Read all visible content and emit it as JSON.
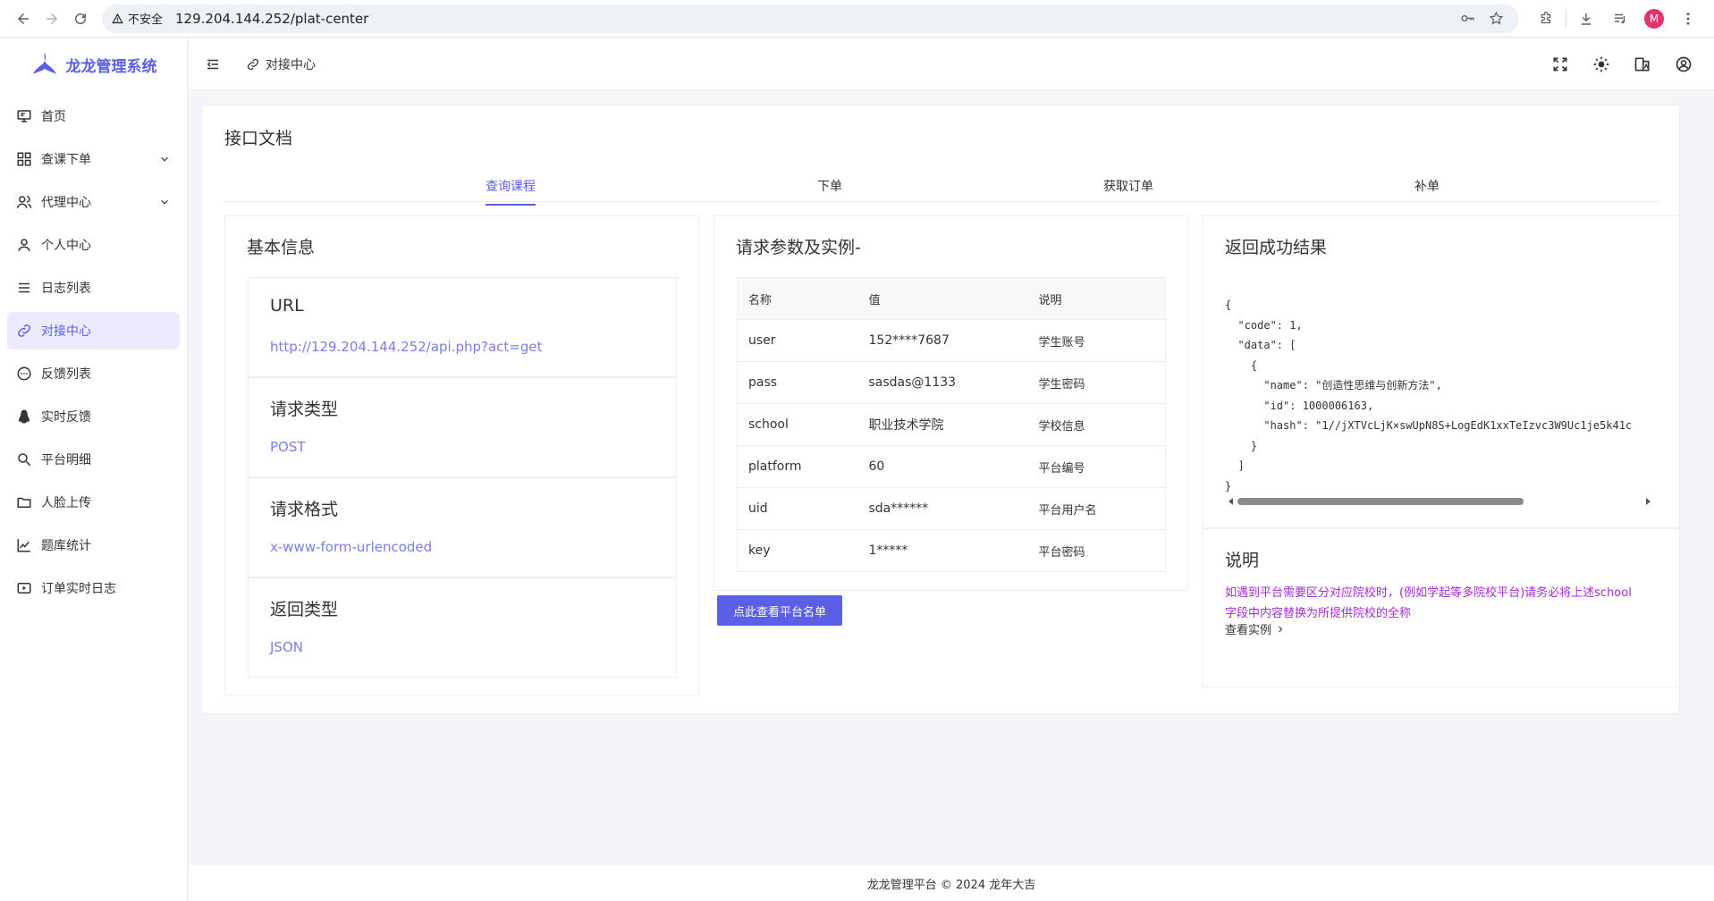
{
  "browser": {
    "insecure_label": "不安全",
    "url": "129.204.144.252/plat-center",
    "profile_initial": "M"
  },
  "sidebar": {
    "logo_text": "龙龙管理系统",
    "items": [
      {
        "label": "首页",
        "icon": "monitor-icon"
      },
      {
        "label": "查课下单",
        "icon": "grid-icon",
        "has_children": true
      },
      {
        "label": "代理中心",
        "icon": "users-icon",
        "has_children": true
      },
      {
        "label": "个人中心",
        "icon": "user-icon"
      },
      {
        "label": "日志列表",
        "icon": "list-icon"
      },
      {
        "label": "对接中心",
        "icon": "link-icon",
        "active": true
      },
      {
        "label": "反馈列表",
        "icon": "chat-icon"
      },
      {
        "label": "实时反馈",
        "icon": "penguin-icon"
      },
      {
        "label": "平台明细",
        "icon": "search-icon"
      },
      {
        "label": "人脸上传",
        "icon": "folder-icon"
      },
      {
        "label": "题库统计",
        "icon": "chart-icon"
      },
      {
        "label": "订单实时日志",
        "icon": "video-icon"
      }
    ]
  },
  "header": {
    "breadcrumb": "对接中心"
  },
  "main": {
    "title": "接口文档",
    "tabs": [
      {
        "label": "查询课程",
        "active": true
      },
      {
        "label": "下单"
      },
      {
        "label": "获取订单"
      },
      {
        "label": "补单"
      }
    ],
    "basic": {
      "title": "基本信息",
      "boxes": [
        {
          "title": "URL",
          "value": "http://129.204.144.252/api.php?act=get"
        },
        {
          "title": "请求类型",
          "value": "POST"
        },
        {
          "title": "请求格式",
          "value": "x-www-form-urlencoded"
        },
        {
          "title": "返回类型",
          "value": "JSON"
        }
      ]
    },
    "params": {
      "title": "请求参数及实例-",
      "headers": [
        "名称",
        "值",
        "说明"
      ],
      "rows": [
        [
          "user",
          "152****7687",
          "学生账号"
        ],
        [
          "pass",
          "sasdas@1133",
          "学生密码"
        ],
        [
          "school",
          "职业技术学院",
          "学校信息"
        ],
        [
          "platform",
          "60",
          "平台编号"
        ],
        [
          "uid",
          "sda******",
          "平台用户名"
        ],
        [
          "key",
          "1*****",
          "平台密码"
        ]
      ],
      "button_label": "点此查看平台名单"
    },
    "result": {
      "title": "返回成功结果",
      "code": "{\n  \"code\": 1,\n  \"data\": [\n    {\n      \"name\": \"创造性思维与创新方法\",\n      \"id\": 1000006163,\n      \"hash\": \"1//jXTVcLjK×swUpN8S+LogEdK1xxTeIzvc3W9Uc1je5k41c\n    }\n  ]\n}"
    },
    "note": {
      "title": "说明",
      "text": "如遇到平台需要区分对应院校时，(例如学起等多院校平台)请务必将上述school字段中内容替换为所提供院校的全称",
      "link": "查看实例"
    }
  },
  "footer": {
    "text": "龙龙管理平台 © 2024 龙年大吉"
  }
}
